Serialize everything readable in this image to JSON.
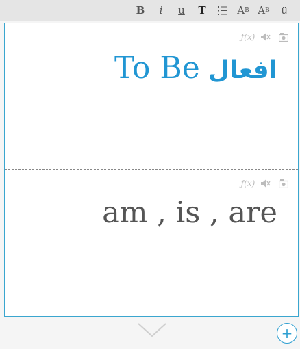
{
  "toolbar": {
    "bold": "B",
    "italic": "i",
    "underline": "u",
    "text_style": "T",
    "list_icon": "list-icon",
    "superscript_base": "A",
    "superscript_mark": "B",
    "subscript_base": "A",
    "subscript_mark": "B",
    "umlaut": "ü"
  },
  "card": {
    "front": {
      "text_en": "To Be",
      "text_ar": "افعال",
      "tools": {
        "fx": "ƒ(x)",
        "audio_icon": "mute-speaker-icon",
        "image_icon": "camera-icon"
      }
    },
    "back": {
      "text": "am , is , are",
      "tools": {
        "fx": "ƒ(x)",
        "audio_icon": "mute-speaker-icon",
        "image_icon": "camera-icon"
      }
    }
  },
  "footer": {
    "expand_icon": "chevron-down-icon",
    "add_label": "+"
  },
  "colors": {
    "accent": "#2196d3",
    "card_border": "#3aa6cf",
    "back_text": "#555555"
  }
}
